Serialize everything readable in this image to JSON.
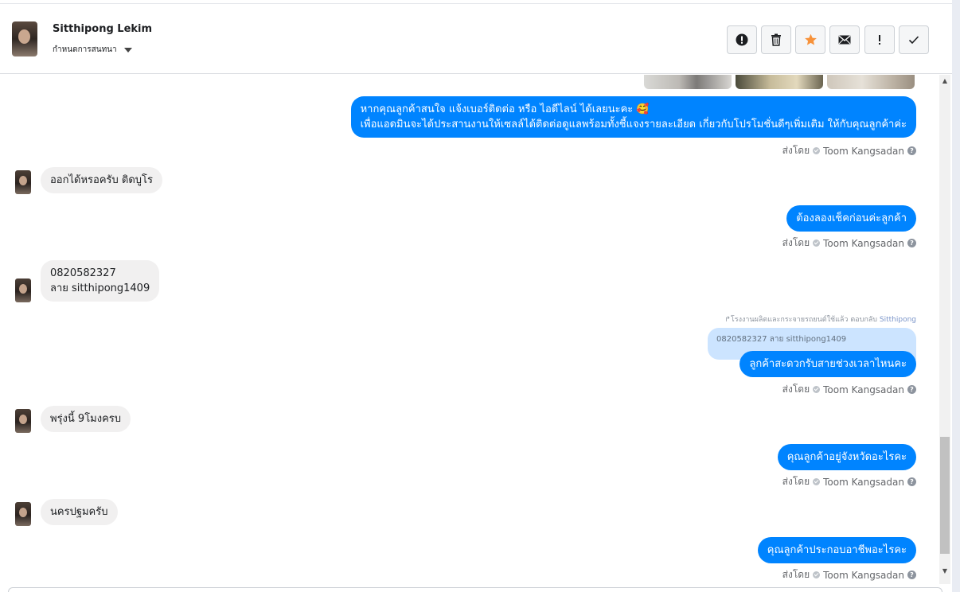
{
  "header": {
    "contact_name": "Sitthipong Lekim",
    "assign_label": "กำหนดการสนทนา",
    "toolbar": {
      "report_label": "!",
      "delete_label": "🗑",
      "star_label": "★",
      "mail_label": "✉",
      "important_label": "!",
      "done_label": "✓"
    }
  },
  "colors": {
    "outgoing_bubble": "#0084ff",
    "incoming_bubble": "#f1f0f0",
    "reply_quote": "#cce4ff",
    "star": "#f7923a"
  },
  "sender_prefix": "ส่งโดย",
  "sender_name": "Toom Kangsadan",
  "messages": [
    {
      "dir": "out",
      "lines": [
        "หากคุณลูกค้าสนใจ แจ้งเบอร์ติดต่อ หรือ ไอดีไลน์ ได้เลยนะคะ 🥰",
        "เพื่อแอดมินจะได้ประสานงานให้เซลล์ได้ติดต่อดูแลพร้อมทั้งชี้แจงรายละเอียด เกี่ยวกับโปรโมชั่นดีๆเพิ่มเติม ให้กับคุณลูกค้าค่ะ"
      ]
    },
    {
      "dir": "in",
      "text": "ออกได้หรอครับ  ติดบูโร"
    },
    {
      "dir": "out",
      "text": "ต้องลองเช็คก่อนค่ะลูกค้า"
    },
    {
      "dir": "in",
      "lines": [
        "0820582327",
        "ลาย sitthipong1409"
      ]
    },
    {
      "dir": "out",
      "reply_meta_prefix": "↱โรงงานผลิตและกระจายรถยนต์ใช้แล้ว ตอบกลับ",
      "reply_meta_name": "Sitthipong",
      "quoted": "0820582327 ลาย sitthipong1409",
      "text": "ลูกค้าสะดวกรับสายช่วงเวลาไหนคะ"
    },
    {
      "dir": "in",
      "text": "พรุ่งนี้ 9โมงครบ"
    },
    {
      "dir": "out",
      "text": "คุณลูกค้าอยู่จังหวัดอะไรคะ"
    },
    {
      "dir": "in",
      "text": "นครปฐมครับ"
    },
    {
      "dir": "out",
      "text": "คุณลูกค้าประกอบอาชีพอะไรคะ"
    }
  ]
}
